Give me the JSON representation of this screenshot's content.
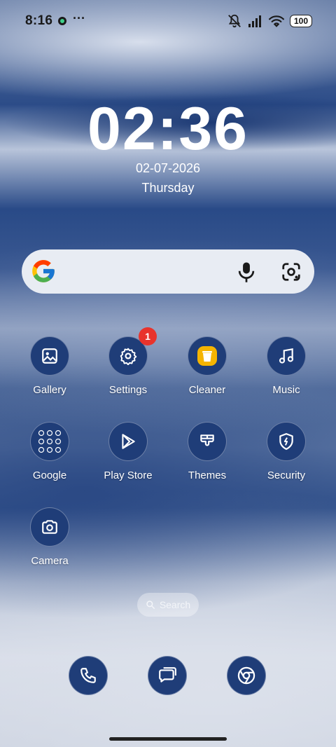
{
  "status_bar": {
    "time": "8:16",
    "battery": "100"
  },
  "clock": {
    "time": "02:36",
    "date": "02-07-2026",
    "day": "Thursday"
  },
  "search_widget": {
    "logo": "google-g-icon"
  },
  "apps": [
    {
      "label": "Gallery",
      "icon": "gallery-icon"
    },
    {
      "label": "Settings",
      "icon": "gear-icon",
      "badge": "1"
    },
    {
      "label": "Cleaner",
      "icon": "trash-icon"
    },
    {
      "label": "Music",
      "icon": "music-note-icon"
    },
    {
      "label": "Google",
      "icon": "folder-icon"
    },
    {
      "label": "Play Store",
      "icon": "play-store-icon"
    },
    {
      "label": "Themes",
      "icon": "brush-icon"
    },
    {
      "label": "Security",
      "icon": "shield-icon"
    },
    {
      "label": "Camera",
      "icon": "camera-icon"
    }
  ],
  "app_drawer_search": {
    "label": "Search"
  },
  "dock": [
    "phone-icon",
    "messages-icon",
    "chrome-icon"
  ],
  "colors": {
    "icon_bg": "#1f3d78",
    "badge": "#e8332c",
    "cleaner_accent": "#f5b400"
  }
}
